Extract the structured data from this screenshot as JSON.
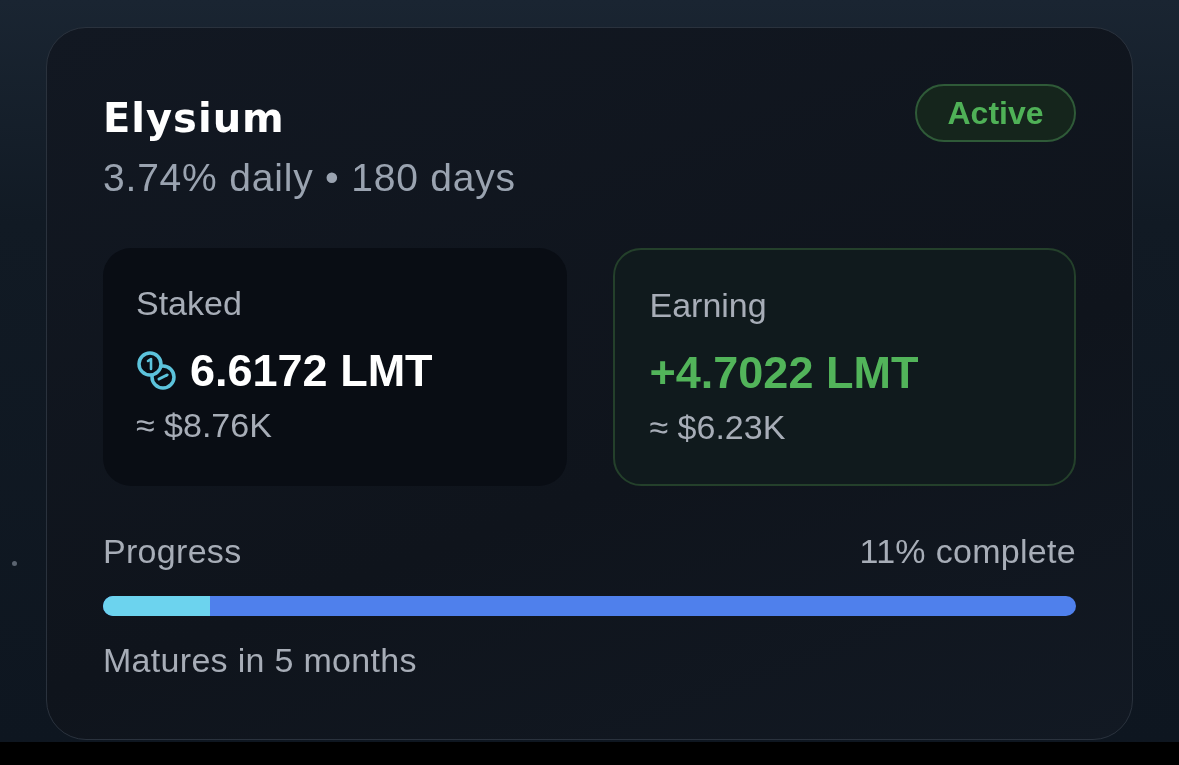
{
  "card": {
    "title": "Elysium",
    "subtitle": "3.74% daily • 180 days",
    "status": {
      "kind": "active",
      "label": "Active"
    }
  },
  "stats": [
    {
      "kind": "staked",
      "label": "Staked",
      "amount": "6.6172 LMT",
      "fiat": "≈ $8.76K"
    },
    {
      "kind": "earning",
      "label": "Earning",
      "amount": "+4.7022 LMT",
      "fiat": "≈ $6.23K"
    }
  ],
  "progress": {
    "label": "Progress",
    "reading": "11% complete",
    "level": 0.11,
    "note": "Matures in 5 months"
  }
}
